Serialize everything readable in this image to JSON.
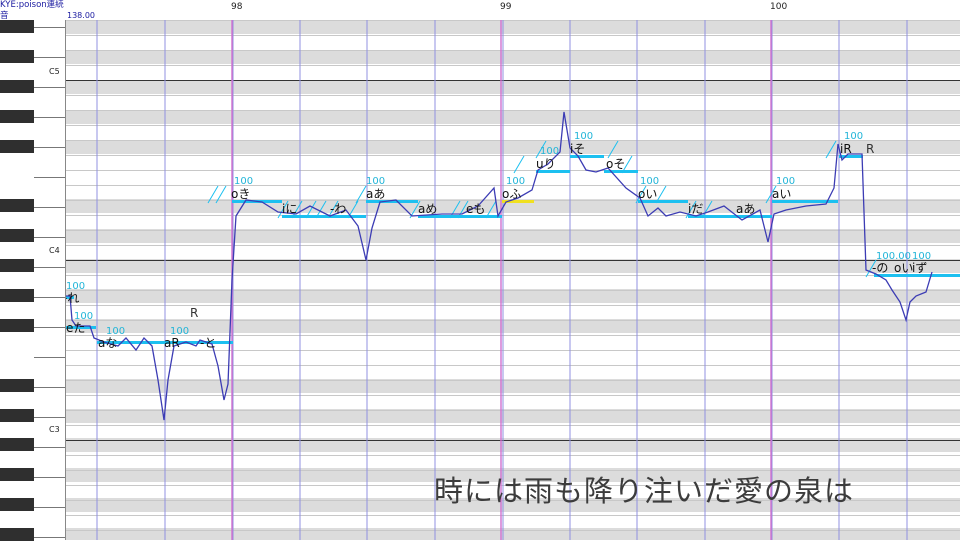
{
  "window": {
    "title": "KYE:poison連続\n音",
    "tempo": "138.00"
  },
  "ruler": {
    "measures": [
      "98",
      "99",
      "100"
    ]
  },
  "piano": {
    "octave_labels": [
      "C5",
      "C4",
      "C3"
    ]
  },
  "colors": {
    "note": "#1cc0f0",
    "pitch_curve": "#3c3cb4",
    "bar_line": "#d070d0",
    "beat_line": "#9090e0",
    "shade_row": "#dcdcdc"
  },
  "notes": [
    {
      "lyric": "-れ",
      "velocity": "100"
    },
    {
      "lyric": "eた",
      "velocity": "100"
    },
    {
      "lyric": "aな",
      "velocity": "100"
    },
    {
      "lyric": "aR",
      "velocity": "100"
    },
    {
      "lyric": "-と",
      "velocity": ""
    },
    {
      "lyric": "oき",
      "velocity": "100"
    },
    {
      "lyric": "iに",
      "velocity": "100"
    },
    {
      "lyric": "-わ",
      "velocity": "100"
    },
    {
      "lyric": "aあ",
      "velocity": "100"
    },
    {
      "lyric": "aめ",
      "velocity": "100"
    },
    {
      "lyric": "eも",
      "velocity": "100"
    },
    {
      "lyric": "oふ",
      "velocity": "100"
    },
    {
      "lyric": "uり",
      "velocity": "100"
    },
    {
      "lyric": "iそ",
      "velocity": "100"
    },
    {
      "lyric": "oそ",
      "velocity": "100"
    },
    {
      "lyric": "oい",
      "velocity": "100"
    },
    {
      "lyric": "iだ",
      "velocity": "100"
    },
    {
      "lyric": "aあ",
      "velocity": "100"
    },
    {
      "lyric": "aい",
      "velocity": "100"
    },
    {
      "lyric": "iR",
      "velocity": "100"
    },
    {
      "lyric": "-の",
      "velocity": "100.00"
    },
    {
      "lyric": "oい",
      "velocity": "100"
    },
    {
      "lyric": "iず",
      "velocity": "100"
    }
  ],
  "rest_labels": [
    "R",
    "R"
  ],
  "subtitle": "時には雨も降り注いだ愛の泉は"
}
